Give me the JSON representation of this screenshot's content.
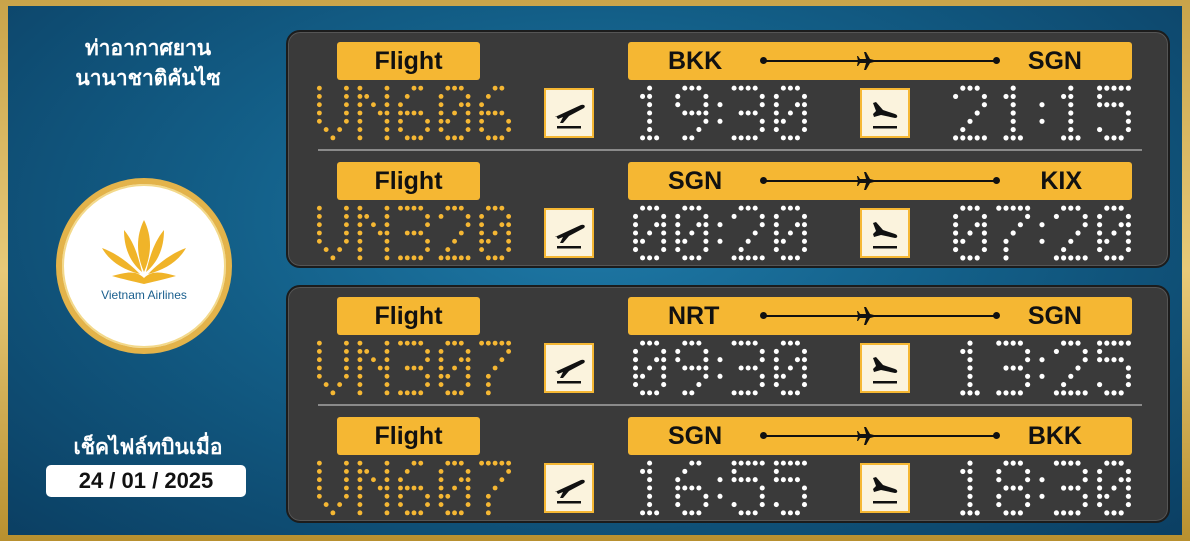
{
  "left_panel": {
    "airport_name_line1": "ท่าอากาศยาน",
    "airport_name_line2": "นานาชาติคันไซ",
    "logo_text": "Vietnam Airlines",
    "checked_label": "เช็คไฟล์ทบินเมื่อ",
    "checked_date": "24 / 01 / 2025"
  },
  "colors": {
    "accent": "#f5b733",
    "board_bg": "#3a3a3a",
    "led_code": "#f5b733",
    "led_time": "#ffffff",
    "panel_bg": "#135f88"
  },
  "boards": [
    {
      "flights": [
        {
          "label": "Flight",
          "code": "VN606",
          "from": "BKK",
          "to": "SGN",
          "depart": "19:30",
          "arrive": "21:15"
        },
        {
          "label": "Flight",
          "code": "VN320",
          "from": "SGN",
          "to": "KIX",
          "depart": "00:20",
          "arrive": "07:20"
        }
      ]
    },
    {
      "flights": [
        {
          "label": "Flight",
          "code": "VN307",
          "from": "NRT",
          "to": "SGN",
          "depart": "09:30",
          "arrive": "13:25"
        },
        {
          "label": "Flight",
          "code": "VN607",
          "from": "SGN",
          "to": "BKK",
          "depart": "16:55",
          "arrive": "18:30"
        }
      ]
    }
  ],
  "icons": {
    "departure": "plane-departure-icon",
    "arrival": "plane-arrival-icon",
    "route": "plane-icon",
    "logo": "lotus-icon"
  }
}
